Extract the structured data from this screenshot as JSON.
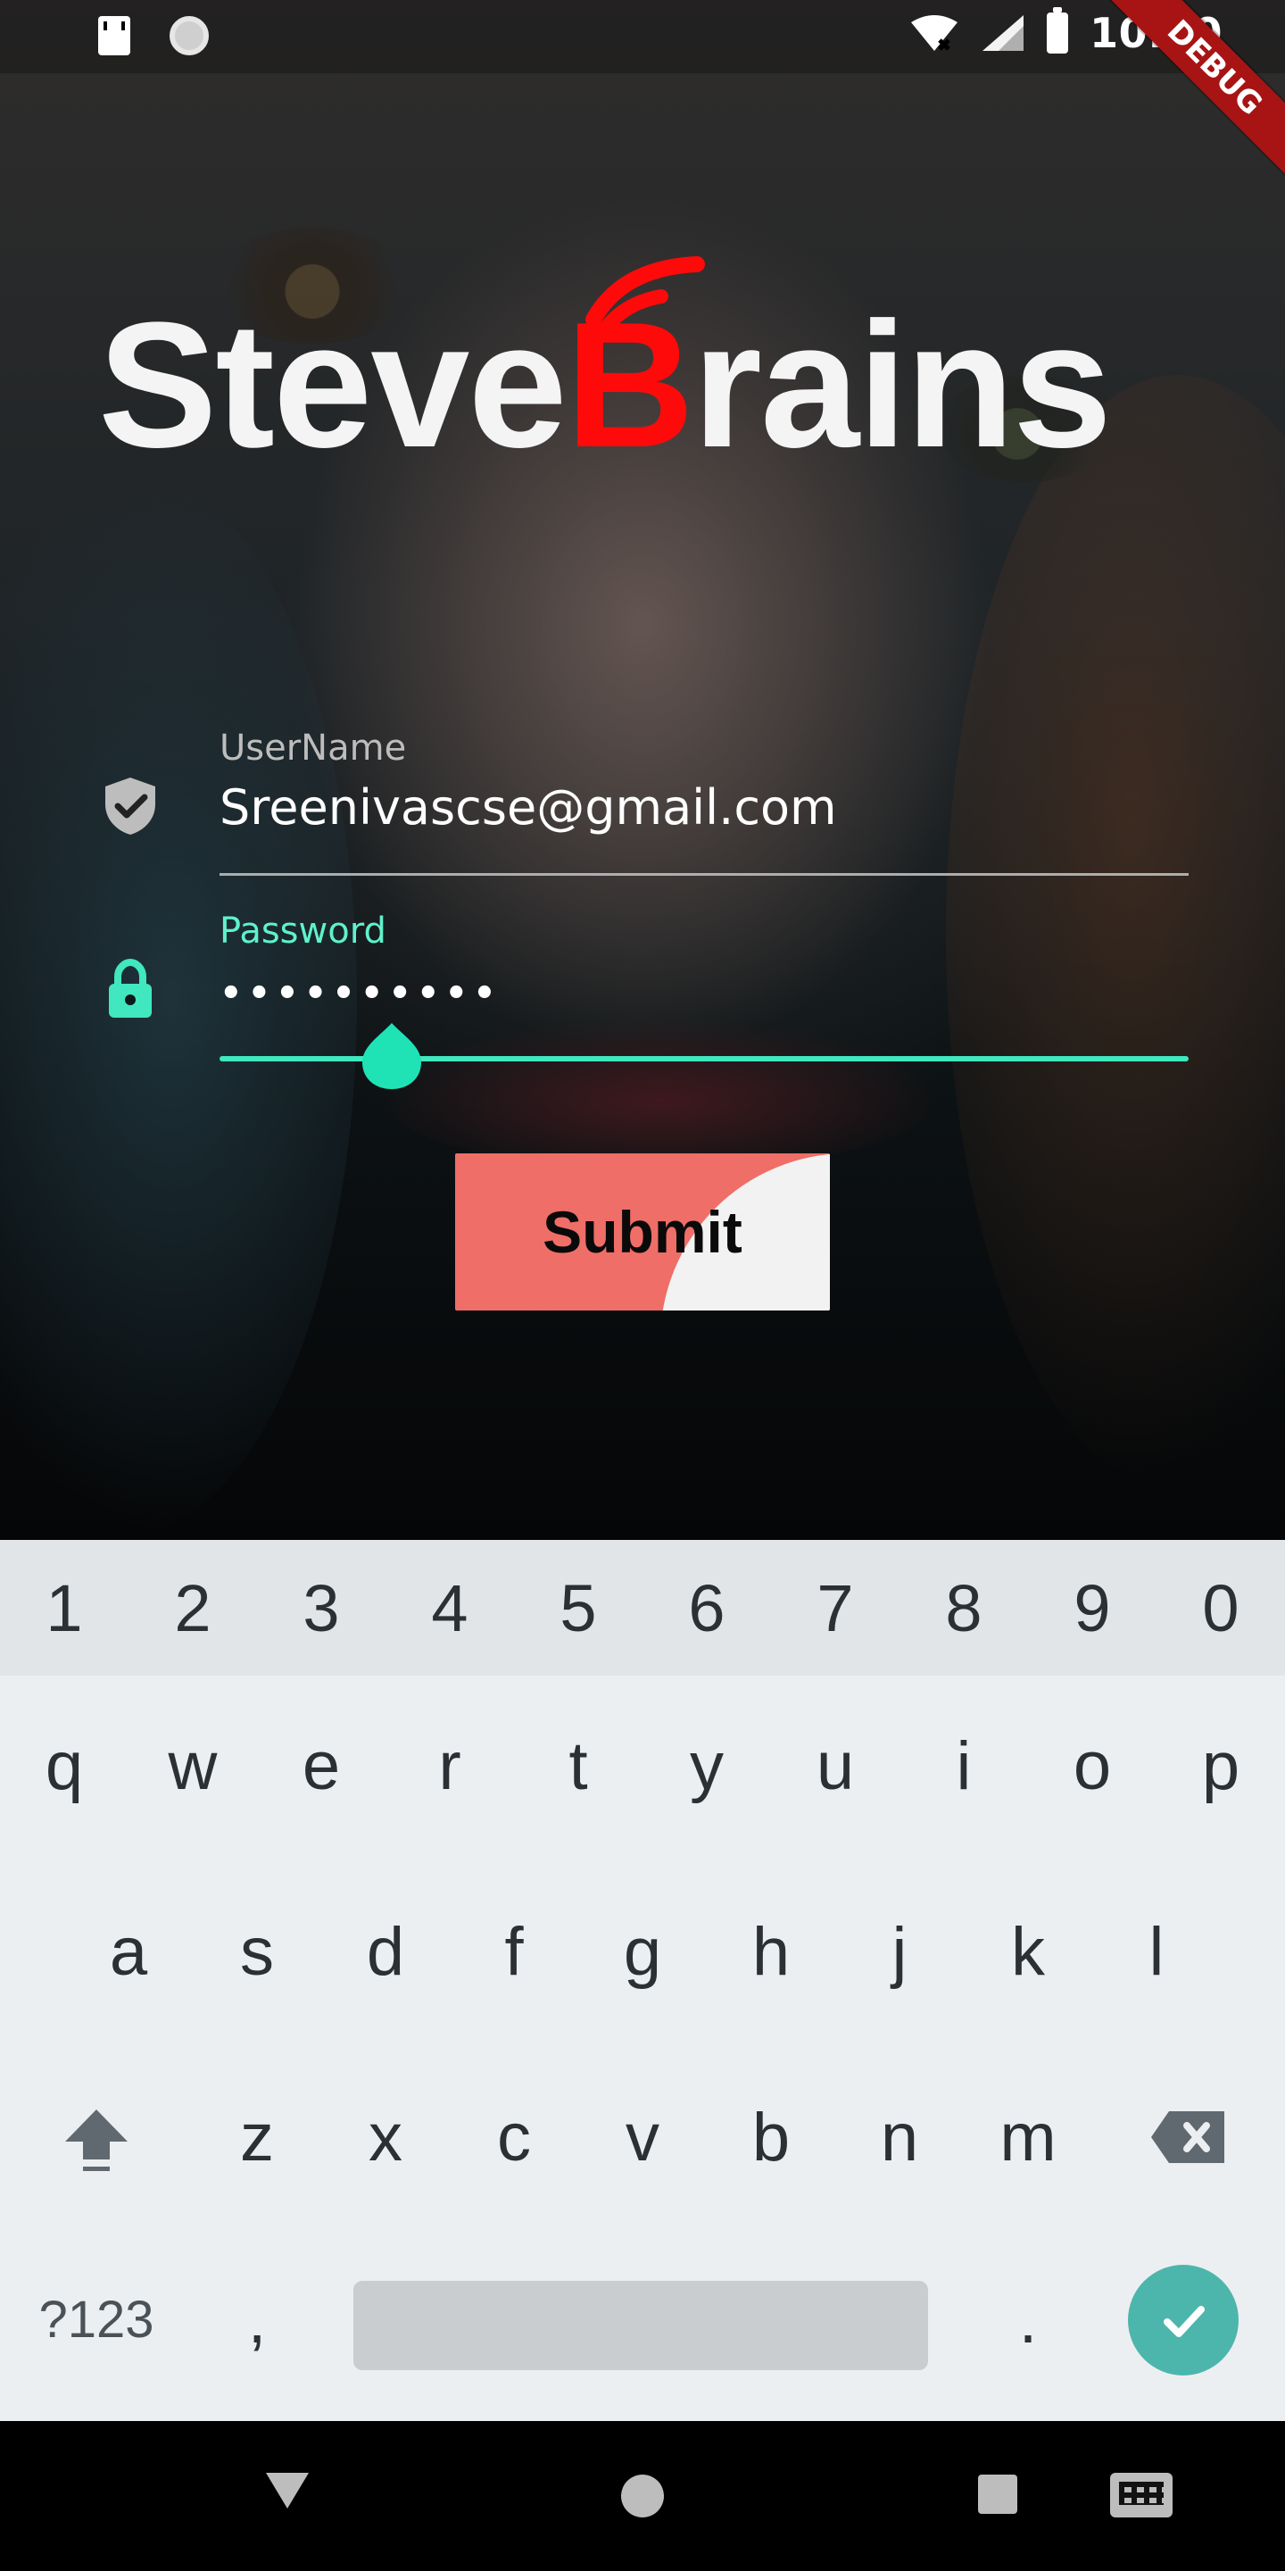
{
  "status_bar": {
    "time": "10:20",
    "icons": [
      "sd-card-icon",
      "sync-icon",
      "wifi-icon",
      "signal-icon",
      "battery-icon"
    ]
  },
  "debug_banner": {
    "text": "DEBUG"
  },
  "logo": {
    "brand_text": "SteveBrains",
    "part_1": "Steve",
    "part_2_highlight": "B",
    "part_3": "rains",
    "accent_color": "#ff0a0a",
    "text_color": "#f4f4f4"
  },
  "form": {
    "username": {
      "label": "UserName",
      "value": "Sreenivascse@gmail.com",
      "icon": "shield-check-icon"
    },
    "password": {
      "label": "Password",
      "masked_value": "••••••••••",
      "icon": "lock-icon",
      "accent_color": "#40e7bf"
    },
    "submit": {
      "label": "Submit",
      "bg_color": "#ef6e67"
    }
  },
  "keyboard": {
    "number_row": [
      "1",
      "2",
      "3",
      "4",
      "5",
      "6",
      "7",
      "8",
      "9",
      "0"
    ],
    "row_1": [
      "q",
      "w",
      "e",
      "r",
      "t",
      "y",
      "u",
      "i",
      "o",
      "p"
    ],
    "row_2": [
      "a",
      "s",
      "d",
      "f",
      "g",
      "h",
      "j",
      "k",
      "l"
    ],
    "row_3": [
      "z",
      "x",
      "c",
      "v",
      "b",
      "n",
      "m"
    ],
    "sym_label": "?123",
    "comma": ",",
    "period": ".",
    "done_icon": "check-icon",
    "shift_icon": "shift-icon",
    "backspace_icon": "backspace-icon"
  },
  "navigation_bar": {
    "icons": [
      "back-icon",
      "home-icon",
      "recents-icon",
      "keyboard-switch-icon"
    ]
  }
}
